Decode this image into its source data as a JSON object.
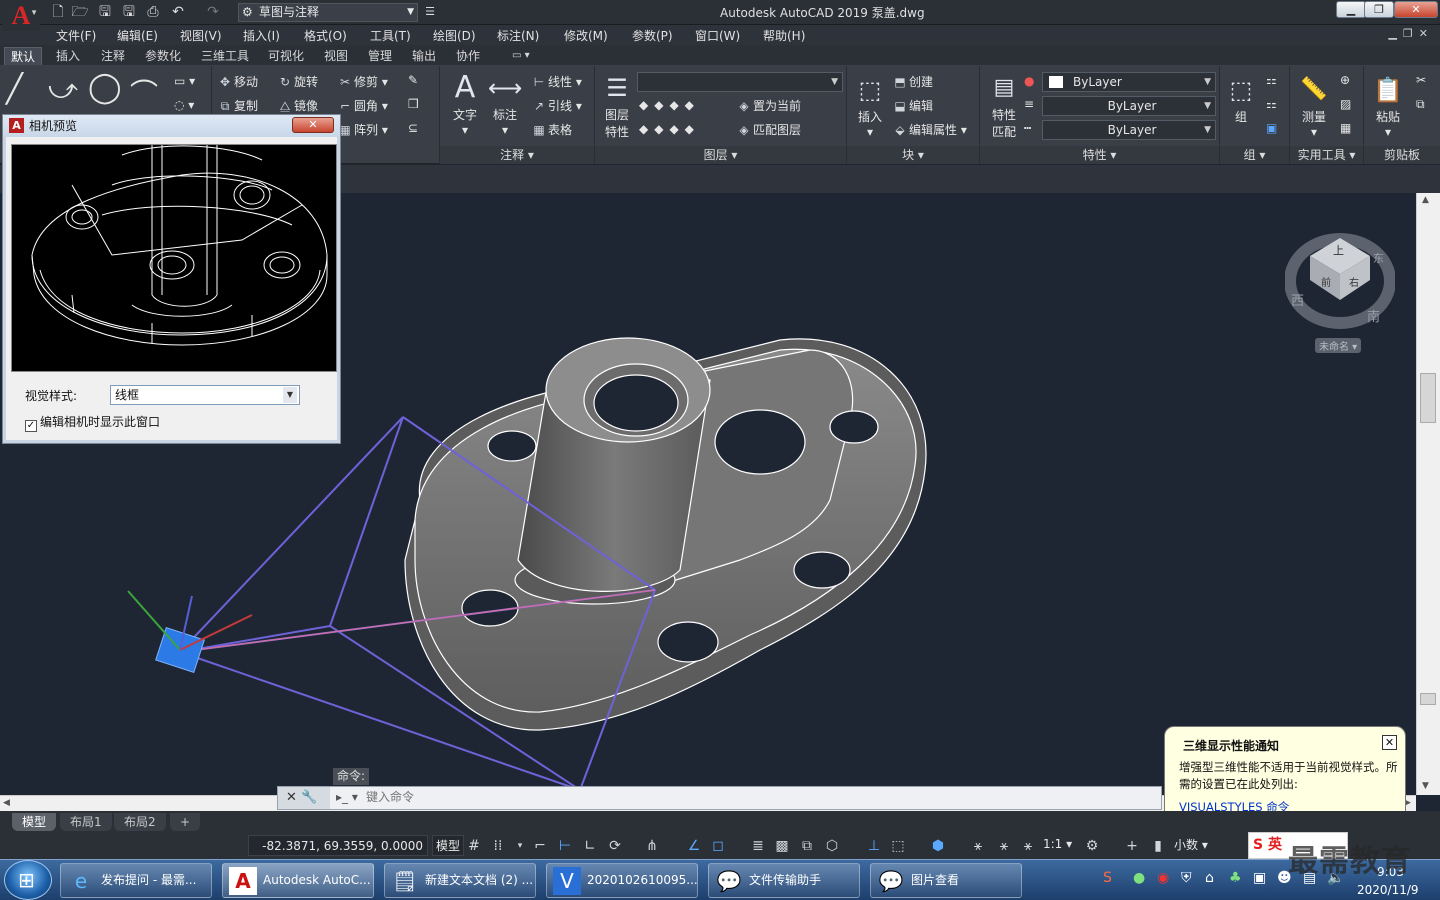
{
  "title_bar": {
    "app_logo": "A",
    "workspace": "草图与注释",
    "title": "Autodesk AutoCAD 2019    泵盖.dwg"
  },
  "menu": [
    "文件(F)",
    "编辑(E)",
    "视图(V)",
    "插入(I)",
    "格式(O)",
    "工具(T)",
    "绘图(D)",
    "标注(N)",
    "修改(M)",
    "参数(P)",
    "窗口(W)",
    "帮助(H)"
  ],
  "ribbon_tabs": [
    "默认",
    "插入",
    "注释",
    "参数化",
    "三维工具",
    "可视化",
    "视图",
    "管理",
    "输出",
    "协作"
  ],
  "ribbon": {
    "modify": {
      "move": "移动",
      "rotate": "旋转",
      "trim": "修剪",
      "copy": "复制",
      "mirror": "镜像",
      "fillet": "圆角",
      "array": "阵列"
    },
    "annotation": {
      "text": "文字",
      "dimension": "标注",
      "linear": "线性",
      "leader": "引线",
      "table": "表格",
      "title": "注释"
    },
    "layers": {
      "props1": "图层",
      "props2": "特性",
      "make_current": "置为当前",
      "match_layer": "匹配图层",
      "title": "图层"
    },
    "block": {
      "insert": "插入",
      "create": "创建",
      "edit": "编辑",
      "edit_attr": "编辑属性",
      "title": "块"
    },
    "properties": {
      "match1": "特性",
      "match2": "匹配",
      "color": "ByLayer",
      "linetype": "ByLayer",
      "lineweight": "ByLayer",
      "title": "特性"
    },
    "groups": {
      "group": "组",
      "title": "组"
    },
    "utilities": {
      "measure": "测量",
      "title": "实用工具"
    },
    "clipboard": {
      "paste": "粘贴",
      "title": "剪贴板"
    }
  },
  "camera_dialog": {
    "title": "相机预览",
    "visual_style_label": "视觉样式:",
    "visual_style_value": "线框",
    "checkbox_label": "编辑相机时显示此窗口",
    "checkbox_checked": true
  },
  "viewcube": {
    "top": "上",
    "front": "前",
    "right": "右",
    "west": "西",
    "south": "南",
    "east": "东",
    "ucs": "未命名"
  },
  "command": {
    "label": "命令:",
    "placeholder": "键入命令"
  },
  "notification": {
    "title": "三维显示性能通知",
    "body": "增强型三维性能不适用于当前视觉样式。所需的设置已在此处列出:",
    "link": "VISUALSTYLES 命令"
  },
  "layout_tabs": [
    "模型",
    "布局1",
    "布局2"
  ],
  "status": {
    "coords": "-82.3871, 69.3559, 0.0000",
    "model": "模型",
    "scale": "1:1",
    "units": "小数"
  },
  "taskbar": {
    "items": [
      {
        "label": "发布提问 - 最需...",
        "icon": "ie-icon"
      },
      {
        "label": "Autodesk AutoC...",
        "icon": "autocad-icon"
      },
      {
        "label": "新建文本文档 (2) ...",
        "icon": "notepad-icon"
      },
      {
        "label": "2020102610095...",
        "icon": "video-icon"
      },
      {
        "label": "文件传输助手",
        "icon": "wechat-icon"
      },
      {
        "label": "图片查看",
        "icon": "wechat-icon"
      }
    ],
    "ime": "英",
    "time": "9:03",
    "date": "2020/11/9"
  },
  "watermark": "最需教育",
  "colors": {
    "canvas": "#1f2633",
    "camera_lines": "#6e62d8",
    "accent": "#d92626"
  }
}
